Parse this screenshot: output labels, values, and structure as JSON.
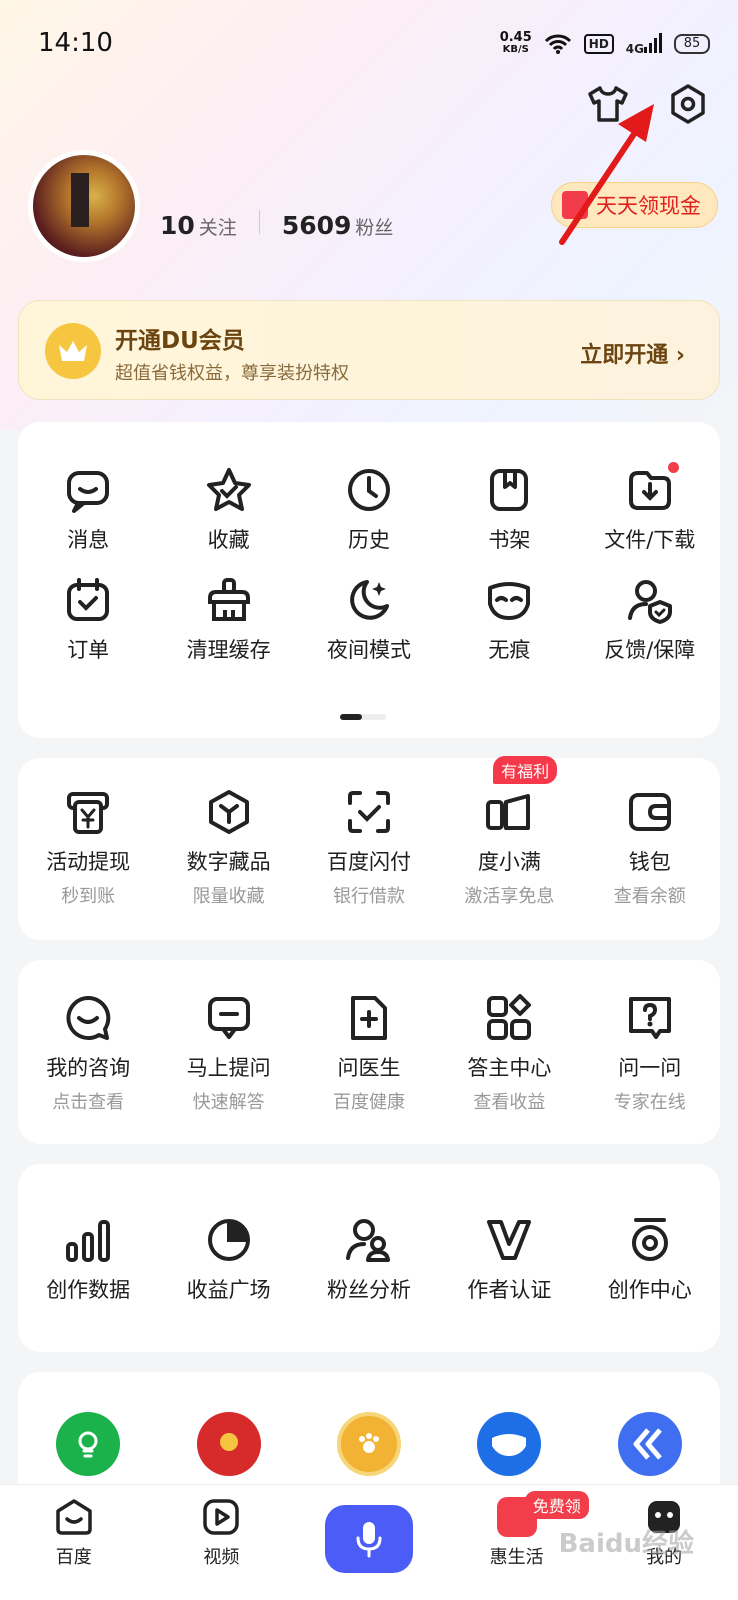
{
  "status_bar": {
    "time": "14:10",
    "speed_value": "0.45",
    "speed_unit": "KB/S",
    "hd": "HD",
    "network": "4G",
    "battery": "85"
  },
  "top_actions": {
    "outfit_icon": "tshirt-icon",
    "settings_icon": "hexagon-gear-icon"
  },
  "profile": {
    "following_count": "10",
    "following_label": "关注",
    "fans_count": "5609",
    "fans_label": "粉丝",
    "cash_button": "天天领现金"
  },
  "vip": {
    "title": "开通DU会员",
    "subtitle": "超值省钱权益，尊享装扮特权",
    "action": "立即开通 ›"
  },
  "tools": [
    {
      "label": "消息",
      "icon": "message-icon"
    },
    {
      "label": "收藏",
      "icon": "star-icon"
    },
    {
      "label": "历史",
      "icon": "clock-icon"
    },
    {
      "label": "书架",
      "icon": "bookshelf-icon"
    },
    {
      "label": "文件/下载",
      "icon": "download-folder-icon"
    },
    {
      "label": "订单",
      "icon": "order-icon"
    },
    {
      "label": "清理缓存",
      "icon": "broom-icon"
    },
    {
      "label": "夜间模式",
      "icon": "moon-icon"
    },
    {
      "label": "无痕",
      "icon": "mask-icon"
    },
    {
      "label": "反馈/保障",
      "icon": "user-shield-icon"
    }
  ],
  "finance": [
    {
      "label": "活动提现",
      "sub": "秒到账"
    },
    {
      "label": "数字藏品",
      "sub": "限量收藏"
    },
    {
      "label": "百度闪付",
      "sub": "银行借款"
    },
    {
      "label": "度小满",
      "sub": "激活享免息",
      "tag": "有福利"
    },
    {
      "label": "钱包",
      "sub": "查看余额"
    }
  ],
  "qa": [
    {
      "label": "我的咨询",
      "sub": "点击查看"
    },
    {
      "label": "马上提问",
      "sub": "快速解答"
    },
    {
      "label": "问医生",
      "sub": "百度健康"
    },
    {
      "label": "答主中心",
      "sub": "查看收益"
    },
    {
      "label": "问一问",
      "sub": "专家在线"
    }
  ],
  "creator": [
    {
      "label": "创作数据"
    },
    {
      "label": "收益广场"
    },
    {
      "label": "粉丝分析"
    },
    {
      "label": "作者认证"
    },
    {
      "label": "创作中心"
    }
  ],
  "services": [
    {
      "icon": "bulb-badge-icon",
      "color": "#1bb24b"
    },
    {
      "icon": "government-emblem-icon",
      "color": "#d72a2a"
    },
    {
      "icon": "paw-medal-icon",
      "color": "#f2b233"
    },
    {
      "icon": "mask-badge-icon",
      "color": "#1e6fe6"
    },
    {
      "icon": "chevron-logo-icon",
      "color": "#3f6ef0"
    }
  ],
  "tabbar": {
    "home": "百度",
    "video": "视频",
    "life": "惠生活",
    "mine": "我的",
    "free_badge": "免费领"
  },
  "watermark": "Baidu经验"
}
